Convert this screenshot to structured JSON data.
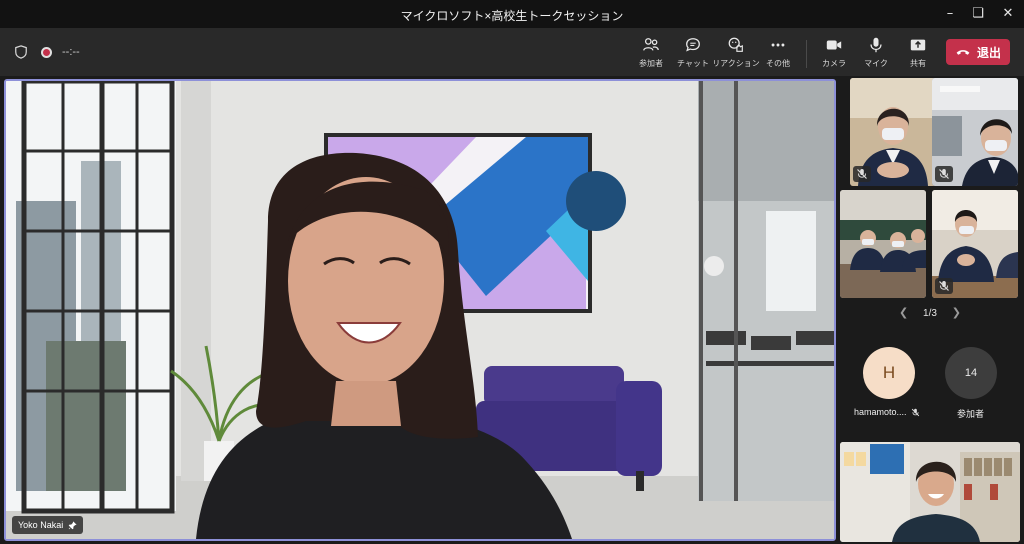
{
  "window": {
    "title": "マイクロソフト×高校生トークセッション",
    "controls": [
      "minimize",
      "maximize",
      "close"
    ]
  },
  "meeting": {
    "timer": "--:--"
  },
  "toolbar": {
    "participants_label": "参加者",
    "chat_label": "チャット",
    "reactions_label": "リアクション",
    "more_label": "その他",
    "camera_label": "カメラ",
    "mic_label": "マイク",
    "share_label": "共有",
    "leave_label": "退出"
  },
  "main_video": {
    "speaker_name": "Yoko Nakai",
    "pinned": true
  },
  "gallery": {
    "page_indicator": "1/3",
    "tiles": [
      {
        "muted": true
      },
      {
        "muted": true
      },
      {
        "muted": false
      },
      {
        "muted": true
      }
    ]
  },
  "overflow": {
    "participant_initial": "H",
    "participant_name": "hamamoto....",
    "participant_muted": true,
    "more_count": "14",
    "more_label": "参加者"
  },
  "colors": {
    "leave": "#c4314b",
    "active_border": "#8d90d8",
    "toolbar": "#292929",
    "titlebar": "#121212"
  }
}
